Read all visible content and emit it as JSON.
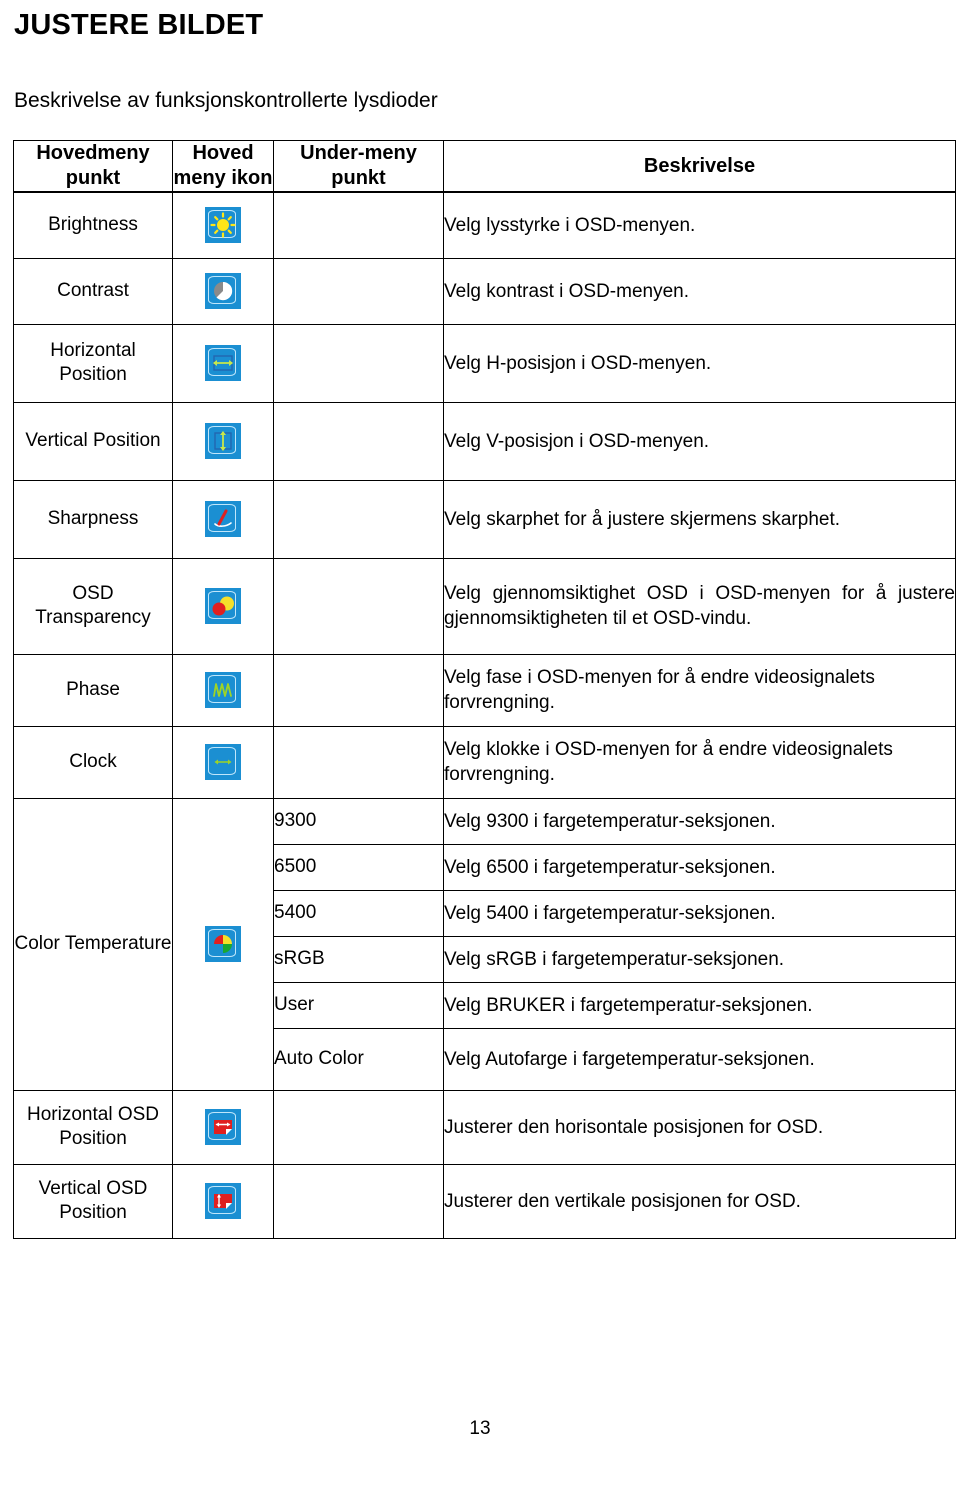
{
  "document": {
    "title": "JUSTERE BILDET",
    "subtitle": "Beskrivelse av funksjonskontrollerte lysdioder",
    "page_number": "13"
  },
  "table": {
    "headers": {
      "main_menu_item": "Hovedmeny punkt",
      "main_menu_icon": "Hoved meny ikon",
      "sub_menu_item": "Under-meny punkt",
      "description": "Beskrivelse"
    },
    "rows": [
      {
        "main": "Brightness",
        "icon": "brightness-sun-icon",
        "sub": "",
        "desc": "Velg lysstyrke i OSD-menyen."
      },
      {
        "main": "Contrast",
        "icon": "contrast-half-circle-icon",
        "sub": "",
        "desc": "Velg kontrast i OSD-menyen."
      },
      {
        "main": "Horizontal Position",
        "icon": "horizontal-position-arrows-icon",
        "sub": "",
        "desc": "Velg H-posisjon i OSD-menyen."
      },
      {
        "main": "Vertical Position",
        "icon": "vertical-position-arrows-icon",
        "sub": "",
        "desc": "Velg V-posisjon i OSD-menyen."
      },
      {
        "main": "Sharpness",
        "icon": "sharpness-pencil-icon",
        "sub": "",
        "desc": "Velg skarphet for å justere skjermens skarphet."
      },
      {
        "main": "OSD Transparency",
        "icon": "osd-transparency-circles-icon",
        "sub": "",
        "desc": "Velg gjennomsiktighet OSD i OSD-menyen for å justere gjennomsiktigheten til et OSD-vindu."
      },
      {
        "main": "Phase",
        "icon": "phase-waveform-icon",
        "sub": "",
        "desc": "Velg fase i OSD-menyen for å endre videosignalets forvrengning."
      },
      {
        "main": "Clock",
        "icon": "clock-arrows-icon",
        "sub": "",
        "desc": "Velg klokke i OSD-menyen for å endre videosignalets forvrengning."
      }
    ],
    "color_temperature": {
      "main": "Color Temperature",
      "icon": "color-temperature-wheel-icon",
      "sub_rows": [
        {
          "sub": "9300",
          "desc": "Velg 9300 i fargetemperatur-seksjonen."
        },
        {
          "sub": "6500",
          "desc": "Velg 6500 i fargetemperatur-seksjonen."
        },
        {
          "sub": "5400",
          "desc": "Velg 5400 i fargetemperatur-seksjonen."
        },
        {
          "sub": "sRGB",
          "desc": "Velg sRGB i fargetemperatur-seksjonen."
        },
        {
          "sub": "User",
          "desc": "Velg BRUKER i fargetemperatur-seksjonen."
        },
        {
          "sub": "Auto Color",
          "desc": "Velg Autofarge i fargetemperatur-seksjonen."
        }
      ]
    },
    "rows_end": [
      {
        "main": "Horizontal OSD Position",
        "icon": "horizontal-osd-position-icon",
        "sub": "",
        "desc": "Justerer den horisontale posisjonen for OSD."
      },
      {
        "main": "Vertical OSD Position",
        "icon": "vertical-osd-position-icon",
        "sub": "",
        "desc": "Justerer den vertikale posisjonen for OSD."
      }
    ]
  },
  "colors": {
    "icon_background": "#1b8fd2",
    "icon_frame": "#bfe6fb",
    "sun_yellow": "#ffe616",
    "accent_red": "#e02020",
    "accent_green": "#36b32a",
    "border": "#000000"
  }
}
